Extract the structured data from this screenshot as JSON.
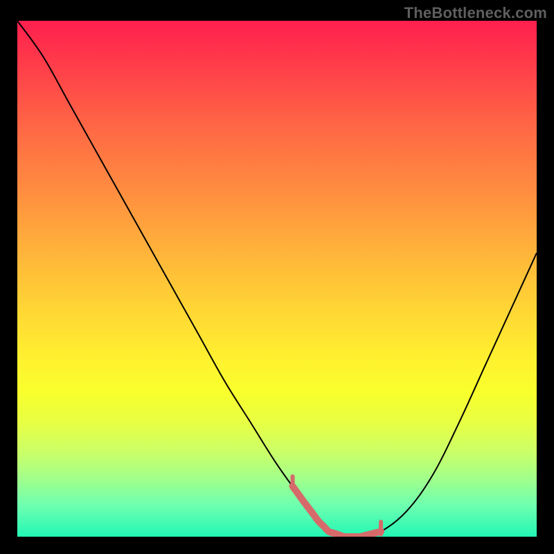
{
  "watermark": "TheBottleneck.com",
  "colors": {
    "background": "#000000",
    "curve": "#000000",
    "accent": "#d66a6a",
    "gradient_stops": [
      "#ff1f4e",
      "#ff3b4a",
      "#ff6545",
      "#ff8a40",
      "#ffb43a",
      "#ffd934",
      "#fff22f",
      "#f8ff2c",
      "#e7ff44",
      "#c8ff6a",
      "#9fff8c",
      "#6dffb0",
      "#22f7b4"
    ]
  },
  "chart_data": {
    "type": "line",
    "title": "",
    "xlabel": "",
    "ylabel": "",
    "ylim": [
      0,
      100
    ],
    "x": [
      0.0,
      0.05,
      0.1,
      0.15,
      0.2,
      0.25,
      0.3,
      0.35,
      0.4,
      0.45,
      0.5,
      0.55,
      0.58,
      0.6,
      0.63,
      0.66,
      0.7,
      0.75,
      0.8,
      0.85,
      0.9,
      0.95,
      1.0
    ],
    "values": [
      100,
      93,
      84,
      75,
      66,
      57,
      48,
      39,
      30,
      22,
      14,
      7,
      3,
      1,
      0,
      0,
      1,
      5,
      12,
      22,
      33,
      44,
      55
    ],
    "notes": "V-shaped curve over a red-to-green vertical gradient; trough ~x≈0.64; accent (pink) segment highlights the trough from ~x≈0.53 to ~x≈0.70 near y≈0–3. No axes, ticks, or legend are rendered."
  }
}
